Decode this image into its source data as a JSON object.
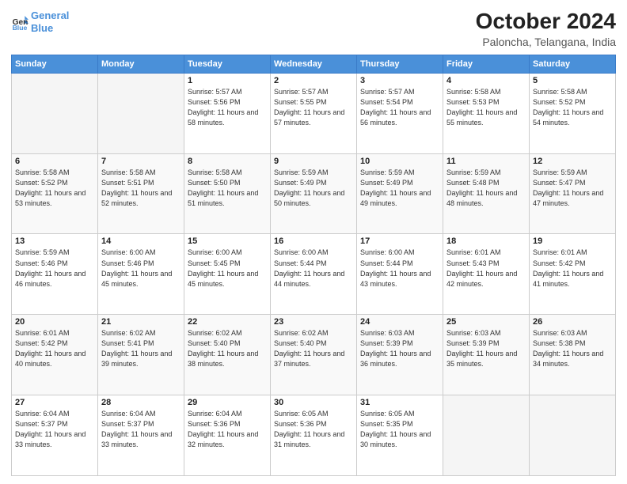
{
  "header": {
    "logo_line1": "General",
    "logo_line2": "Blue",
    "title": "October 2024",
    "subtitle": "Paloncha, Telangana, India"
  },
  "weekdays": [
    "Sunday",
    "Monday",
    "Tuesday",
    "Wednesday",
    "Thursday",
    "Friday",
    "Saturday"
  ],
  "weeks": [
    [
      {
        "day": "",
        "info": ""
      },
      {
        "day": "",
        "info": ""
      },
      {
        "day": "1",
        "info": "Sunrise: 5:57 AM\nSunset: 5:56 PM\nDaylight: 11 hours\nand 58 minutes."
      },
      {
        "day": "2",
        "info": "Sunrise: 5:57 AM\nSunset: 5:55 PM\nDaylight: 11 hours\nand 57 minutes."
      },
      {
        "day": "3",
        "info": "Sunrise: 5:57 AM\nSunset: 5:54 PM\nDaylight: 11 hours\nand 56 minutes."
      },
      {
        "day": "4",
        "info": "Sunrise: 5:58 AM\nSunset: 5:53 PM\nDaylight: 11 hours\nand 55 minutes."
      },
      {
        "day": "5",
        "info": "Sunrise: 5:58 AM\nSunset: 5:52 PM\nDaylight: 11 hours\nand 54 minutes."
      }
    ],
    [
      {
        "day": "6",
        "info": "Sunrise: 5:58 AM\nSunset: 5:52 PM\nDaylight: 11 hours\nand 53 minutes."
      },
      {
        "day": "7",
        "info": "Sunrise: 5:58 AM\nSunset: 5:51 PM\nDaylight: 11 hours\nand 52 minutes."
      },
      {
        "day": "8",
        "info": "Sunrise: 5:58 AM\nSunset: 5:50 PM\nDaylight: 11 hours\nand 51 minutes."
      },
      {
        "day": "9",
        "info": "Sunrise: 5:59 AM\nSunset: 5:49 PM\nDaylight: 11 hours\nand 50 minutes."
      },
      {
        "day": "10",
        "info": "Sunrise: 5:59 AM\nSunset: 5:49 PM\nDaylight: 11 hours\nand 49 minutes."
      },
      {
        "day": "11",
        "info": "Sunrise: 5:59 AM\nSunset: 5:48 PM\nDaylight: 11 hours\nand 48 minutes."
      },
      {
        "day": "12",
        "info": "Sunrise: 5:59 AM\nSunset: 5:47 PM\nDaylight: 11 hours\nand 47 minutes."
      }
    ],
    [
      {
        "day": "13",
        "info": "Sunrise: 5:59 AM\nSunset: 5:46 PM\nDaylight: 11 hours\nand 46 minutes."
      },
      {
        "day": "14",
        "info": "Sunrise: 6:00 AM\nSunset: 5:46 PM\nDaylight: 11 hours\nand 45 minutes."
      },
      {
        "day": "15",
        "info": "Sunrise: 6:00 AM\nSunset: 5:45 PM\nDaylight: 11 hours\nand 45 minutes."
      },
      {
        "day": "16",
        "info": "Sunrise: 6:00 AM\nSunset: 5:44 PM\nDaylight: 11 hours\nand 44 minutes."
      },
      {
        "day": "17",
        "info": "Sunrise: 6:00 AM\nSunset: 5:44 PM\nDaylight: 11 hours\nand 43 minutes."
      },
      {
        "day": "18",
        "info": "Sunrise: 6:01 AM\nSunset: 5:43 PM\nDaylight: 11 hours\nand 42 minutes."
      },
      {
        "day": "19",
        "info": "Sunrise: 6:01 AM\nSunset: 5:42 PM\nDaylight: 11 hours\nand 41 minutes."
      }
    ],
    [
      {
        "day": "20",
        "info": "Sunrise: 6:01 AM\nSunset: 5:42 PM\nDaylight: 11 hours\nand 40 minutes."
      },
      {
        "day": "21",
        "info": "Sunrise: 6:02 AM\nSunset: 5:41 PM\nDaylight: 11 hours\nand 39 minutes."
      },
      {
        "day": "22",
        "info": "Sunrise: 6:02 AM\nSunset: 5:40 PM\nDaylight: 11 hours\nand 38 minutes."
      },
      {
        "day": "23",
        "info": "Sunrise: 6:02 AM\nSunset: 5:40 PM\nDaylight: 11 hours\nand 37 minutes."
      },
      {
        "day": "24",
        "info": "Sunrise: 6:03 AM\nSunset: 5:39 PM\nDaylight: 11 hours\nand 36 minutes."
      },
      {
        "day": "25",
        "info": "Sunrise: 6:03 AM\nSunset: 5:39 PM\nDaylight: 11 hours\nand 35 minutes."
      },
      {
        "day": "26",
        "info": "Sunrise: 6:03 AM\nSunset: 5:38 PM\nDaylight: 11 hours\nand 34 minutes."
      }
    ],
    [
      {
        "day": "27",
        "info": "Sunrise: 6:04 AM\nSunset: 5:37 PM\nDaylight: 11 hours\nand 33 minutes."
      },
      {
        "day": "28",
        "info": "Sunrise: 6:04 AM\nSunset: 5:37 PM\nDaylight: 11 hours\nand 33 minutes."
      },
      {
        "day": "29",
        "info": "Sunrise: 6:04 AM\nSunset: 5:36 PM\nDaylight: 11 hours\nand 32 minutes."
      },
      {
        "day": "30",
        "info": "Sunrise: 6:05 AM\nSunset: 5:36 PM\nDaylight: 11 hours\nand 31 minutes."
      },
      {
        "day": "31",
        "info": "Sunrise: 6:05 AM\nSunset: 5:35 PM\nDaylight: 11 hours\nand 30 minutes."
      },
      {
        "day": "",
        "info": ""
      },
      {
        "day": "",
        "info": ""
      }
    ]
  ]
}
